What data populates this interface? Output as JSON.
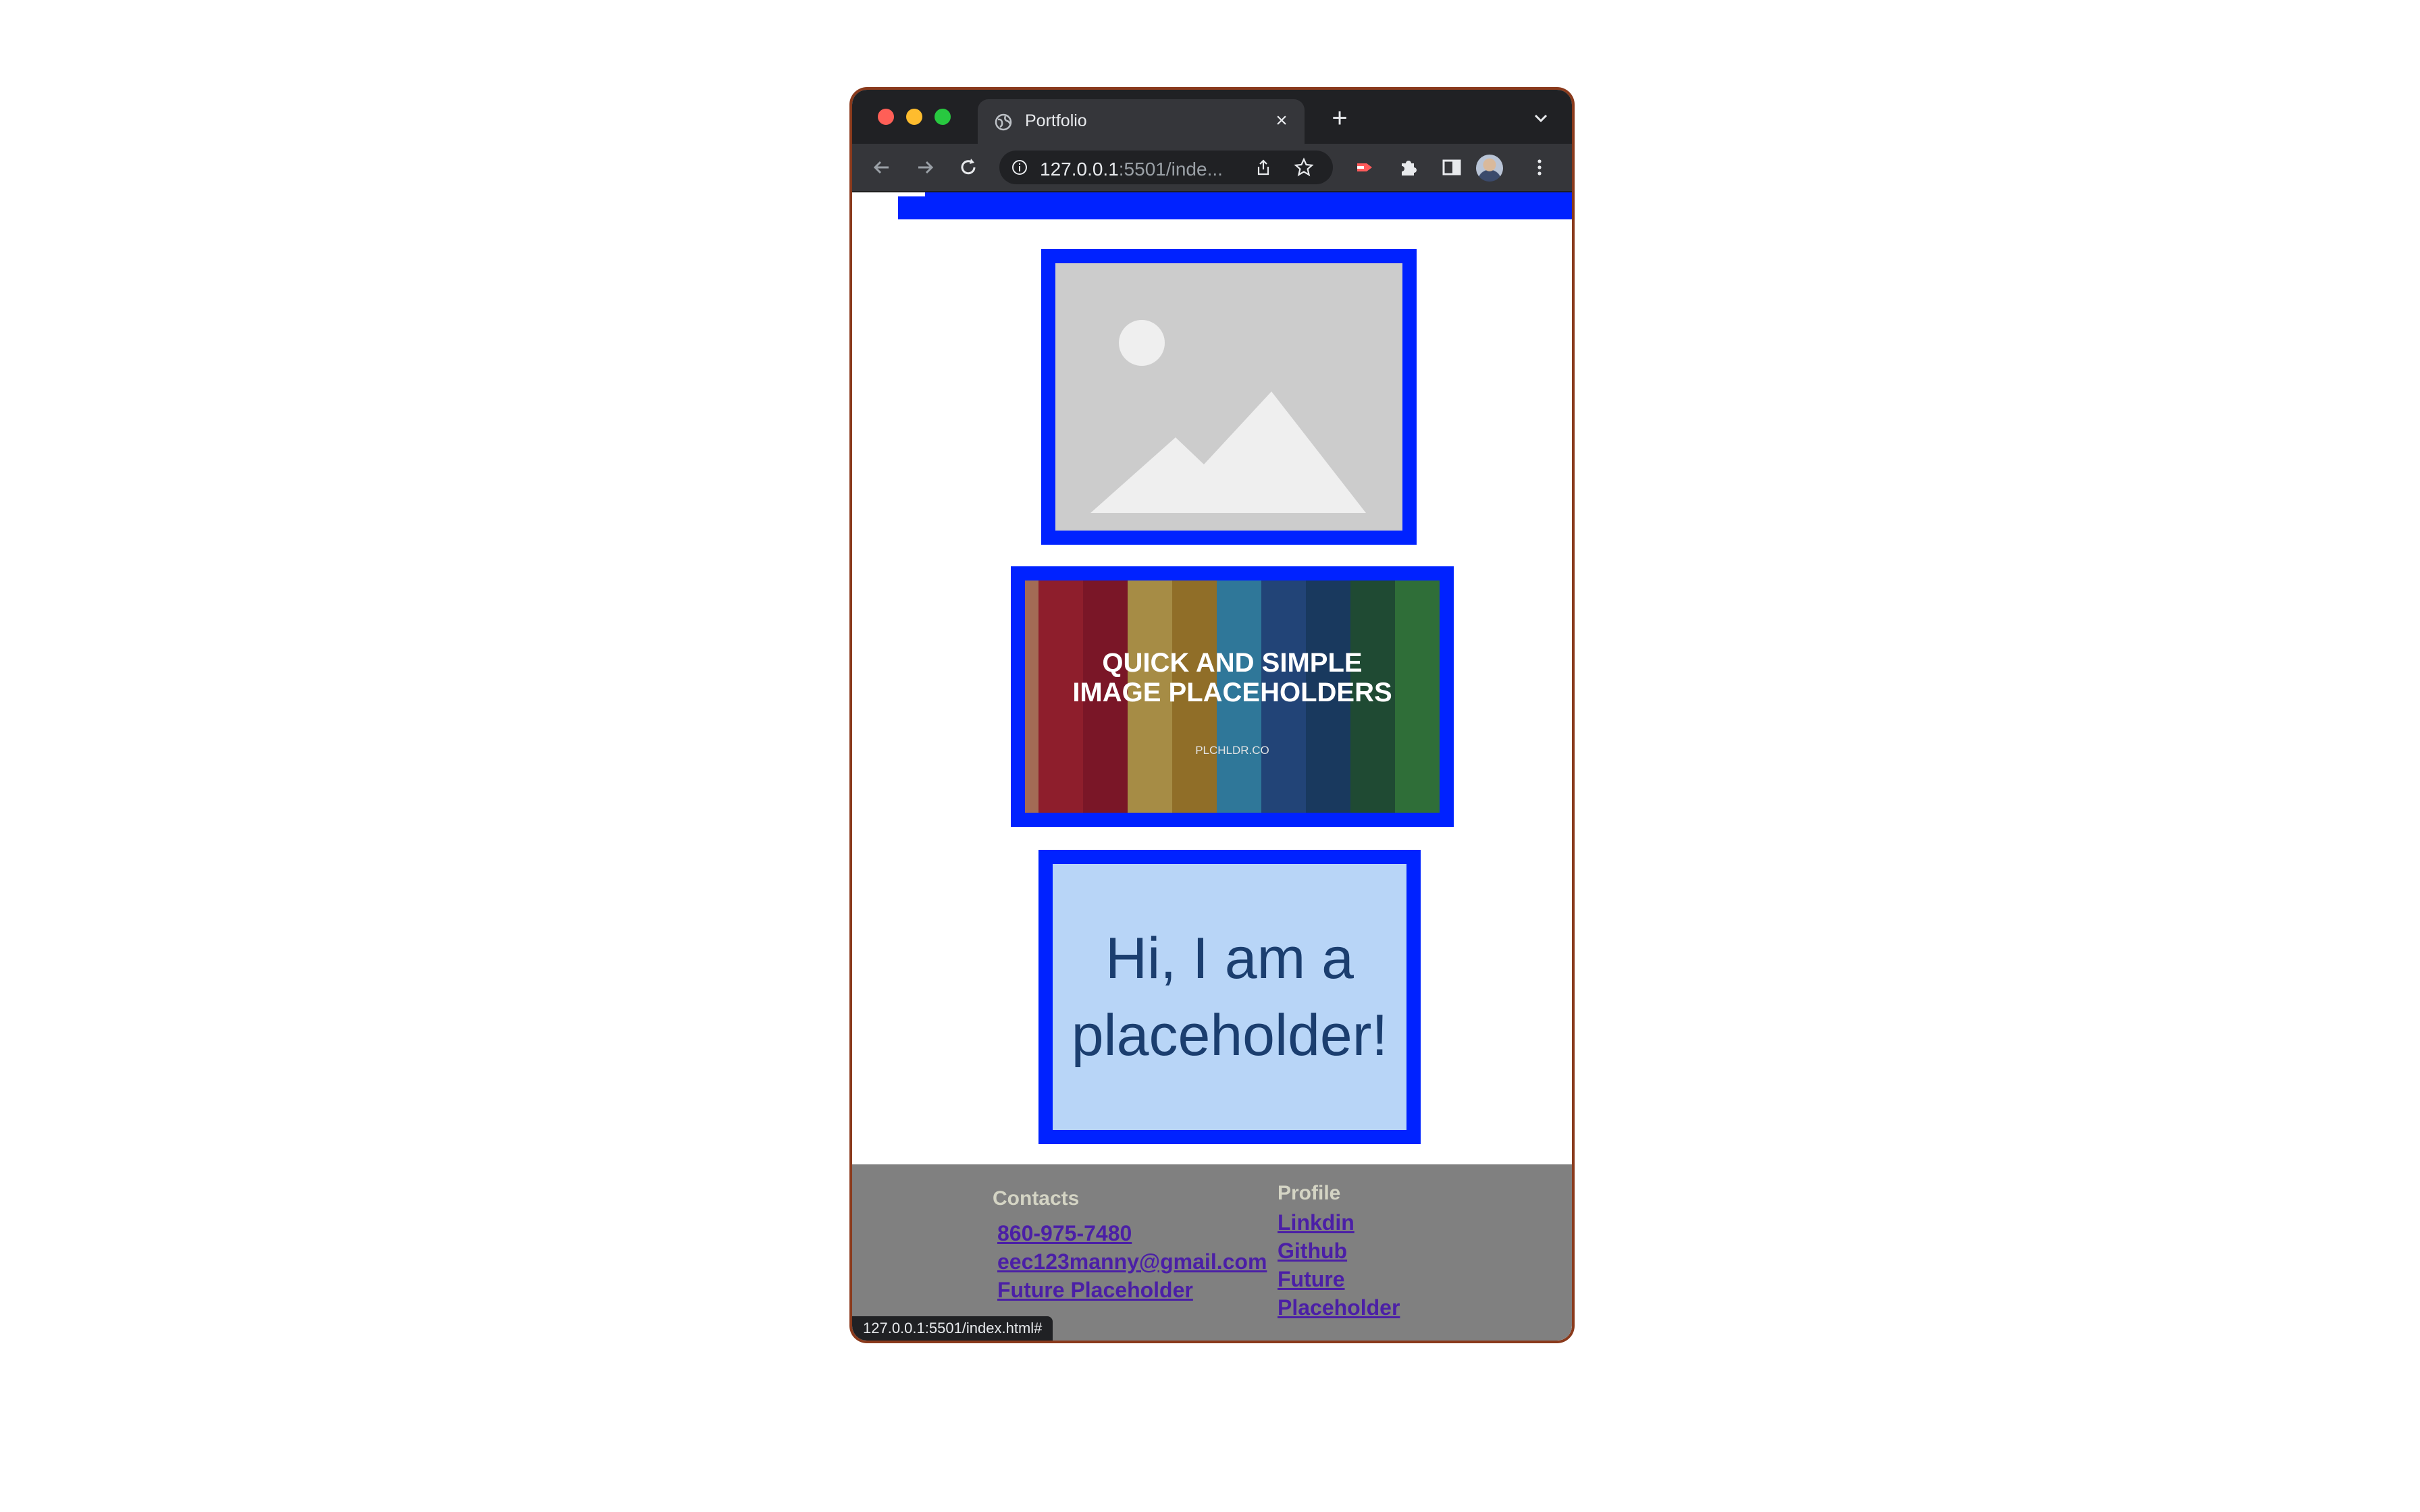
{
  "browser": {
    "tab_title": "Portfolio",
    "tab_close_label": "×",
    "new_tab_label": "+",
    "url_host": "127.0.0.1",
    "url_rest": ":5501/inde...",
    "status_url": "127.0.0.1:5501/index.html#"
  },
  "gallery": {
    "banner_line1": "QUICK AND SIMPLE",
    "banner_line2": "IMAGE PLACEHOLDERS",
    "banner_site": "PLCHLDR.CO",
    "placeholder_text": "Hi, I am a placeholder!",
    "stripe_colors": [
      "#a36b55",
      "#8e1e2c",
      "#7a1627",
      "#a68c45",
      "#906e28",
      "#2f7799",
      "#224477",
      "#19395e",
      "#1f4a33",
      "#2f6e38"
    ]
  },
  "footer": {
    "contacts_heading": "Contacts",
    "contacts": [
      "860-975-7480",
      "eec123manny@gmail.com",
      "Future Placeholder"
    ],
    "profile_heading": "Profile",
    "profile_links": [
      "Linkdin",
      "Github",
      "Future",
      "Placeholder"
    ]
  },
  "colors": {
    "frame_blue": "#0022ff",
    "footer_gray": "#808080",
    "link_purple": "#4b1fa6",
    "placeholder_bg": "#b8d5f7",
    "placeholder_text": "#1b3e6f"
  }
}
